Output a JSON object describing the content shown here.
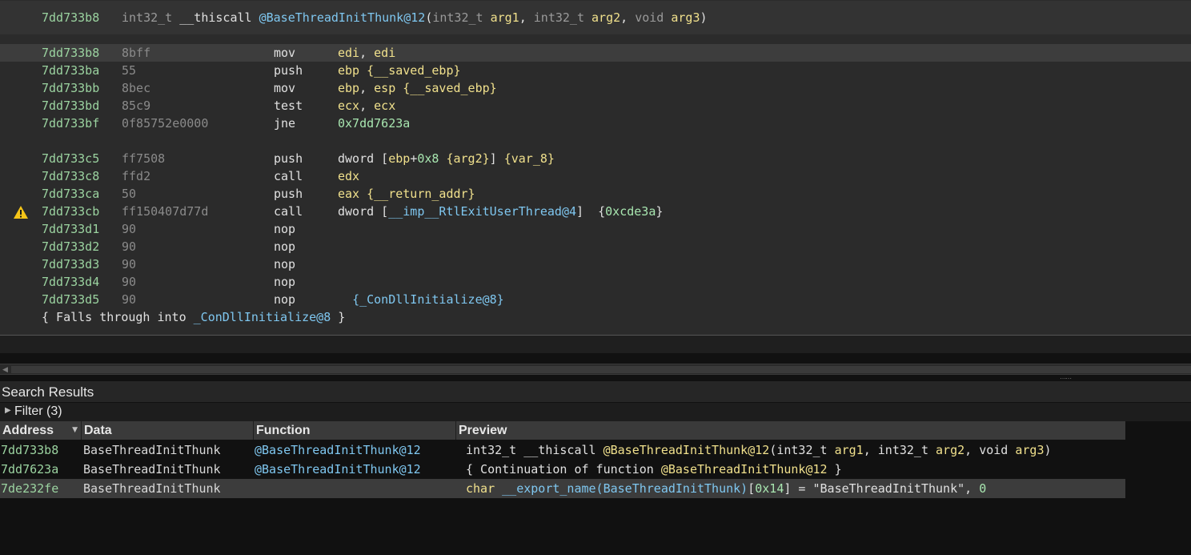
{
  "signature": {
    "address": "7dd733b8",
    "ret_type": "int32_t",
    "conv": "__thiscall",
    "name": "@BaseThreadInitThunk@12",
    "params": [
      {
        "type": "int32_t",
        "name": "arg1"
      },
      {
        "type": "int32_t",
        "name": "arg2"
      },
      {
        "type": "void",
        "name": "arg3"
      }
    ]
  },
  "disassembly": [
    {
      "address": "7dd733b8",
      "bytes": "8bff",
      "mnemonic": "mov",
      "operands": "edi, edi"
    },
    {
      "address": "7dd733ba",
      "bytes": "55",
      "mnemonic": "push",
      "operands": "ebp {__saved_ebp}"
    },
    {
      "address": "7dd733bb",
      "bytes": "8bec",
      "mnemonic": "mov",
      "operands": "ebp, esp {__saved_ebp}"
    },
    {
      "address": "7dd733bd",
      "bytes": "85c9",
      "mnemonic": "test",
      "operands": "ecx, ecx"
    },
    {
      "address": "7dd733bf",
      "bytes": "0f85752e0000",
      "mnemonic": "jne",
      "operands": "0x7dd7623a"
    },
    {
      "address": "7dd733c5",
      "bytes": "ff7508",
      "mnemonic": "push",
      "operands": "dword [ebp+0x8 {arg2}] {var_8}"
    },
    {
      "address": "7dd733c8",
      "bytes": "ffd2",
      "mnemonic": "call",
      "operands": "edx"
    },
    {
      "address": "7dd733ca",
      "bytes": "50",
      "mnemonic": "push",
      "operands": "eax {__return_addr}"
    },
    {
      "address": "7dd733cb",
      "bytes": "ff150407d77d",
      "mnemonic": "call",
      "operands": "dword [__imp__RtlExitUserThread@4]  {0xcde3a}"
    },
    {
      "address": "7dd733d1",
      "bytes": "90",
      "mnemonic": "nop",
      "operands": ""
    },
    {
      "address": "7dd733d2",
      "bytes": "90",
      "mnemonic": "nop",
      "operands": ""
    },
    {
      "address": "7dd733d3",
      "bytes": "90",
      "mnemonic": "nop",
      "operands": ""
    },
    {
      "address": "7dd733d4",
      "bytes": "90",
      "mnemonic": "nop",
      "operands": ""
    },
    {
      "address": "7dd733d5",
      "bytes": "90",
      "mnemonic": "nop",
      "operands": "  {_ConDllInitialize@8}"
    }
  ],
  "fallthrough_text": "{ Falls through into _ConDllInitialize@8 }",
  "search_results": {
    "title": "Search Results",
    "filter_label": "Filter (3)",
    "columns": [
      "Address",
      "Data",
      "Function",
      "Preview"
    ],
    "rows": [
      {
        "address": "7dd733b8",
        "data": "BaseThreadInitThunk",
        "function": "@BaseThreadInitThunk@12",
        "preview": "int32_t __thiscall @BaseThreadInitThunk@12(int32_t arg1, int32_t arg2, void arg3)"
      },
      {
        "address": "7dd7623a",
        "data": "BaseThreadInitThunk",
        "function": "@BaseThreadInitThunk@12",
        "preview": "{ Continuation of function @BaseThreadInitThunk@12 }"
      },
      {
        "address": "7de232fe",
        "data": "BaseThreadInitThunk",
        "function": "",
        "preview": "char __export_name(BaseThreadInitThunk)[0x14] = \"BaseThreadInitThunk\", 0"
      }
    ]
  },
  "icons": {
    "warning": "warning-icon",
    "sort": "sort-desc-icon",
    "expand": "disclosure-triangle-icon",
    "scroll_left": "scroll-left-arrow-icon"
  },
  "colors": {
    "address": "#9bd3a0",
    "register": "#f0e08c",
    "symbol": "#7fc7f0",
    "warning": "#f5c518"
  }
}
